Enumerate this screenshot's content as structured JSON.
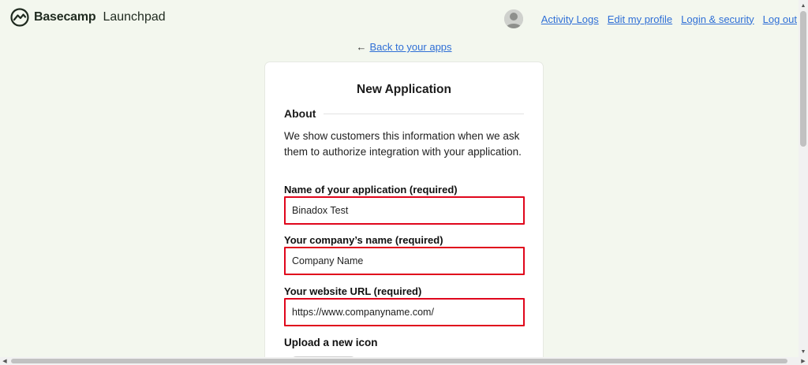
{
  "app": {
    "brand": "Basecamp",
    "product": "Launchpad"
  },
  "nav": {
    "items": [
      "Activity Logs",
      "Edit my profile",
      "Login & security",
      "Log out"
    ]
  },
  "back_link": {
    "arrow": "←",
    "label": "Back to your apps"
  },
  "form": {
    "title": "New Application",
    "section": "About",
    "description": "We show customers this information when we ask them to authorize integration with your application.",
    "fields": [
      {
        "label": "Name of your application (required)",
        "value": "Binadox Test"
      },
      {
        "label": "Your company’s name (required)",
        "value": "Company Name"
      },
      {
        "label": "Your website URL (required)",
        "value": "https://www.companyname.com/"
      }
    ],
    "upload_label": "Upload a new icon"
  },
  "colors": {
    "background": "#f3f7ee",
    "link": "#2f6fd6",
    "highlight_border": "#e0061c"
  },
  "icons": {
    "logo": "basecamp-logo-icon",
    "avatar": "user-avatar-icon"
  }
}
